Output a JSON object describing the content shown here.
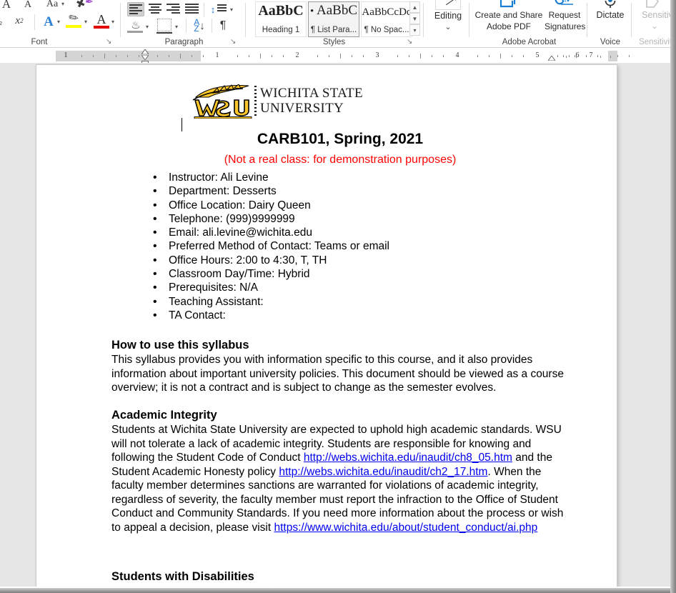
{
  "ribbon": {
    "groups": [
      {
        "label": "Font"
      },
      {
        "label": "Paragraph"
      },
      {
        "label": "Styles"
      },
      {
        "label": "Adobe Acrobat"
      },
      {
        "label": "Voice"
      },
      {
        "label": "Sensitivity"
      }
    ],
    "font": {
      "label": "Font",
      "superscript_label": "x²",
      "text_effects_label": "A",
      "highlight_label": "A",
      "font_color_label": "A",
      "grow_font_label": "A",
      "shrink_font_label": "A",
      "change_case_label": "Aa",
      "clear_formatting_label": "A",
      "dialog_launcher": "↘"
    },
    "paragraph": {
      "label": "Paragraph",
      "line_spacing_label": "↕",
      "sort_label": "A↓",
      "show_marks_label": "¶",
      "dialog_launcher": "↘"
    },
    "styles": {
      "label": "Styles",
      "dialog_launcher": "↘",
      "items": [
        {
          "preview": "AaBbC",
          "name": "Heading 1",
          "selected": false
        },
        {
          "preview": "AaBbC",
          "name": "¶ List Para...",
          "selected": true,
          "bulleted": true
        },
        {
          "preview": "AaBbCcDc",
          "name": "¶ No Spac...",
          "selected": false
        }
      ],
      "scroll_up": "▲",
      "scroll_down": "▼",
      "scroll_more": "▾"
    },
    "editing": {
      "label": "Editing",
      "caret": "⌄"
    },
    "acrobat": {
      "label": "Adobe Acrobat",
      "create_share_line1": "Create and Share",
      "create_share_line2": "Adobe PDF",
      "request_line1": "Request",
      "request_line2": "Signatures"
    },
    "voice": {
      "label": "Voice",
      "dictate_label": "Dictate"
    },
    "sensitivity": {
      "label": "Sensitivity",
      "button_label": "Sensitiv",
      "caret": "⌄"
    }
  },
  "ruler": {
    "numbers": [
      "1",
      "1",
      "2",
      "3",
      "4",
      "5",
      "6",
      "7"
    ],
    "left_indent_marker": "first-line-indent-marker",
    "right_indent_marker": "right-indent-marker"
  },
  "document": {
    "logo": {
      "alt": "Wichita State University logo",
      "wordmark_line1": "WICHITA STATE",
      "wordmark_line2": "UNIVERSITY",
      "monogram": "WSU"
    },
    "title": "CARB101, Spring, 2021",
    "subtitle": "(Not a real class: for demonstration purposes)",
    "subtitle_color": "#ff0000",
    "info_list": [
      "Instructor: Ali Levine",
      "Department: Desserts",
      "Office Location: Dairy Queen",
      "Telephone: (999)9999999",
      "Email: ali.levine@wichita.edu",
      "Preferred Method of Contact: Teams or email",
      "Office Hours: 2:00 to 4:30, T, TH",
      "Classroom Day/Time: Hybrid",
      "Prerequisites: N/A",
      "Teaching Assistant:",
      "TA Contact:"
    ],
    "sections": {
      "how_to": {
        "heading": "How to use this syllabus",
        "body": "This syllabus provides you with information specific to this course, and it also provides information about important university policies. This document should be viewed as a course overview; it is not a contract and is subject to change as the semester evolves."
      },
      "academic_integrity": {
        "heading": "Academic Integrity",
        "part1": "Students at Wichita State University are expected to uphold high academic standards. WSU will not tolerate a lack of academic integrity. Students are responsible for knowing and following the Student Code of Conduct ",
        "link1": "http://webs.wichita.edu/inaudit/ch8_05.htm",
        "part2": " and the Student Academic Honesty policy ",
        "link2": "http://webs.wichita.edu/inaudit/ch2_17.htm",
        "part3": ". When the faculty member determines sanctions are warranted for violations of academic integrity, regardless of severity, the faculty member must report the infraction to the Office of Student Conduct and Community Standards. If you need more information about the process or wish to appeal a decision, please visit ",
        "link3": "https://www.wichita.edu/about/student_conduct/ai.php",
        "link_color": "#0000ee"
      },
      "disabilities": {
        "heading": "Students with Disabilities"
      }
    }
  }
}
